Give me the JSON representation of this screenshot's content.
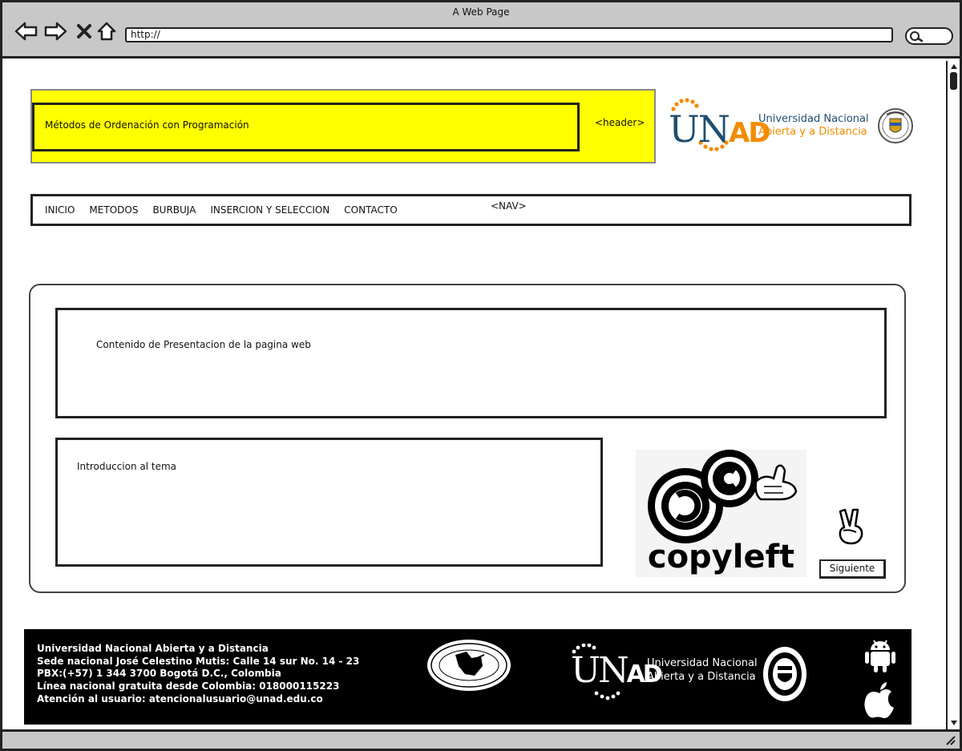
{
  "window": {
    "title": "A Web Page",
    "url": "http://"
  },
  "header": {
    "title": "Métodos de Ordenación con Programación",
    "tag": "<header>"
  },
  "logo": {
    "u": "U",
    "n": "N",
    "ad": "AD",
    "line1": "Universidad Nacional",
    "line2": "Abierta y a Distancia",
    "color_blue": "#1f4e6e",
    "color_orange": "#f28c00"
  },
  "nav": {
    "items": [
      {
        "label": "INICIO"
      },
      {
        "label": "METODOS"
      },
      {
        "label": "BURBUJA"
      },
      {
        "label": "INSERCION Y SELECCION"
      },
      {
        "label": "CONTACTO"
      }
    ],
    "tag": "<NAV>"
  },
  "main": {
    "content_text": "Contenido de Presentacion de la pagina web",
    "intro_text": "Introduccion al tema",
    "copyleft_text": "copyleft",
    "next_label": "Siguiente"
  },
  "footer": {
    "lines": [
      "Universidad Nacional Abierta y a Distancia",
      "Sede nacional José Celestino Mutis: Calle 14 sur No. 14 - 23",
      "PBX:(+57) 1 344 3700 Bogotá D.C., Colombia",
      "Línea nacional gratuita desde Colombia: 018000115223",
      "Atención al usuario: atencionalusuario@unad.edu.co"
    ],
    "unad_u": "U",
    "unad_n": "N",
    "unad_ad": "AD",
    "unad_line1": "Universidad Nacional",
    "unad_line2": "Abierta y a Distancia"
  },
  "colors": {
    "header_bg": "#ffff00",
    "chrome_bg": "#c8c8c8",
    "footer_bg": "#000000"
  }
}
